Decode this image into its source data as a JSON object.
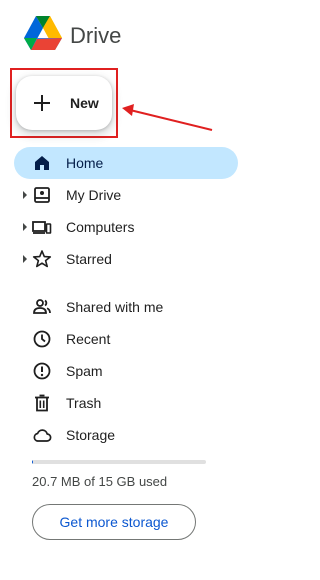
{
  "header": {
    "app_title": "Drive",
    "logo_icon": "google-drive-logo"
  },
  "new_button": {
    "label": "New",
    "icon": "plus-icon"
  },
  "nav": {
    "items": [
      {
        "label": "Home",
        "icon": "home-icon",
        "active": true,
        "expandable": false
      },
      {
        "label": "My Drive",
        "icon": "my-drive-icon",
        "active": false,
        "expandable": true
      },
      {
        "label": "Computers",
        "icon": "computers-icon",
        "active": false,
        "expandable": true
      },
      {
        "label": "Starred",
        "icon": "star-icon",
        "active": false,
        "expandable": true
      },
      {
        "label": "Shared with me",
        "icon": "people-icon",
        "active": false,
        "expandable": false
      },
      {
        "label": "Recent",
        "icon": "clock-icon",
        "active": false,
        "expandable": false
      },
      {
        "label": "Spam",
        "icon": "spam-icon",
        "active": false,
        "expandable": false
      },
      {
        "label": "Trash",
        "icon": "trash-icon",
        "active": false,
        "expandable": false
      },
      {
        "label": "Storage",
        "icon": "cloud-icon",
        "active": false,
        "expandable": false
      }
    ]
  },
  "storage": {
    "used_text": "20.7 MB of 15 GB used",
    "used_fraction": 0.0014,
    "button_label": "Get more storage"
  },
  "colors": {
    "active_bg": "#c2e7ff",
    "accent": "#0b57d0",
    "annotation": "#e02020"
  }
}
